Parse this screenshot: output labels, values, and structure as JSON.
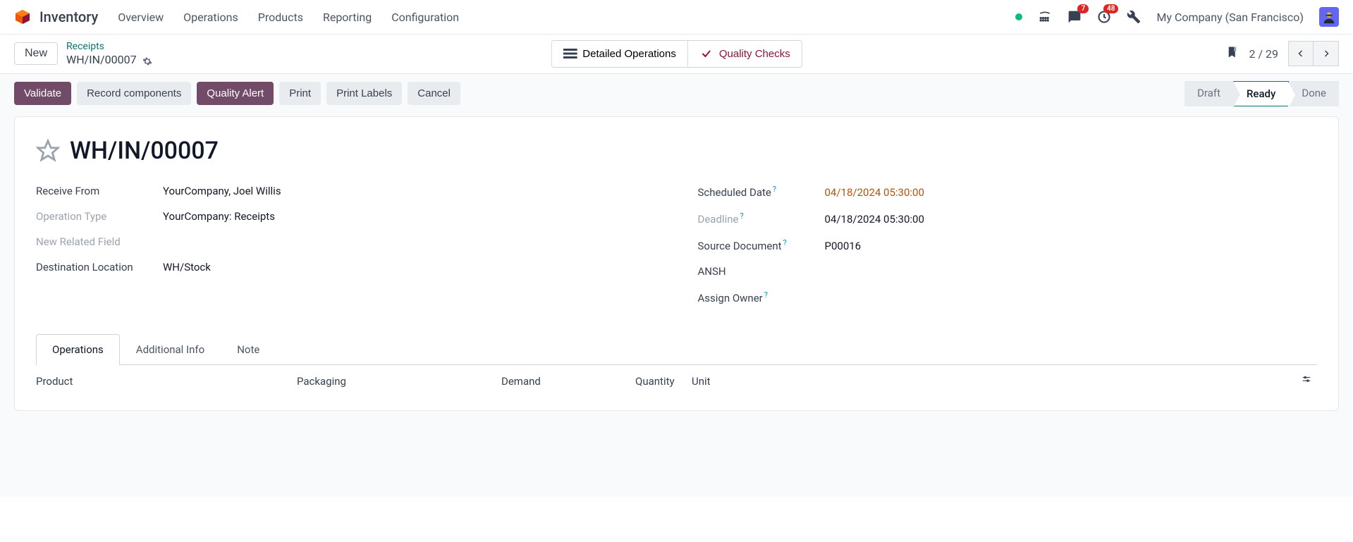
{
  "nav": {
    "brand": "Inventory",
    "menu": [
      "Overview",
      "Operations",
      "Products",
      "Reporting",
      "Configuration"
    ],
    "chat_badge": "7",
    "activity_badge": "48",
    "company": "My Company (San Francisco)"
  },
  "subheader": {
    "new_label": "New",
    "breadcrumb_parent": "Receipts",
    "breadcrumb_current": "WH/IN/00007",
    "detailed_ops": "Detailed Operations",
    "quality_checks": "Quality Checks",
    "pager": "2 / 29"
  },
  "toolbar": {
    "validate": "Validate",
    "record_components": "Record components",
    "quality_alert": "Quality Alert",
    "print": "Print",
    "print_labels": "Print Labels",
    "cancel": "Cancel"
  },
  "status": {
    "draft": "Draft",
    "ready": "Ready",
    "done": "Done"
  },
  "record": {
    "title": "WH/IN/00007",
    "left": {
      "receive_from_label": "Receive From",
      "receive_from": "YourCompany, Joel Willis",
      "op_type_label": "Operation Type",
      "op_type": "YourCompany: Receipts",
      "new_related_label": "New Related Field",
      "dest_loc_label": "Destination Location",
      "dest_loc": "WH/Stock"
    },
    "right": {
      "sched_label": "Scheduled Date",
      "sched": "04/18/2024 05:30:00",
      "deadline_label": "Deadline",
      "deadline": "04/18/2024 05:30:00",
      "source_label": "Source Document",
      "source": "P00016",
      "ansh": "ANSH",
      "assign_owner_label": "Assign Owner"
    }
  },
  "tabs": {
    "operations": "Operations",
    "additional_info": "Additional Info",
    "note": "Note"
  },
  "table": {
    "product": "Product",
    "packaging": "Packaging",
    "demand": "Demand",
    "quantity": "Quantity",
    "unit": "Unit"
  }
}
